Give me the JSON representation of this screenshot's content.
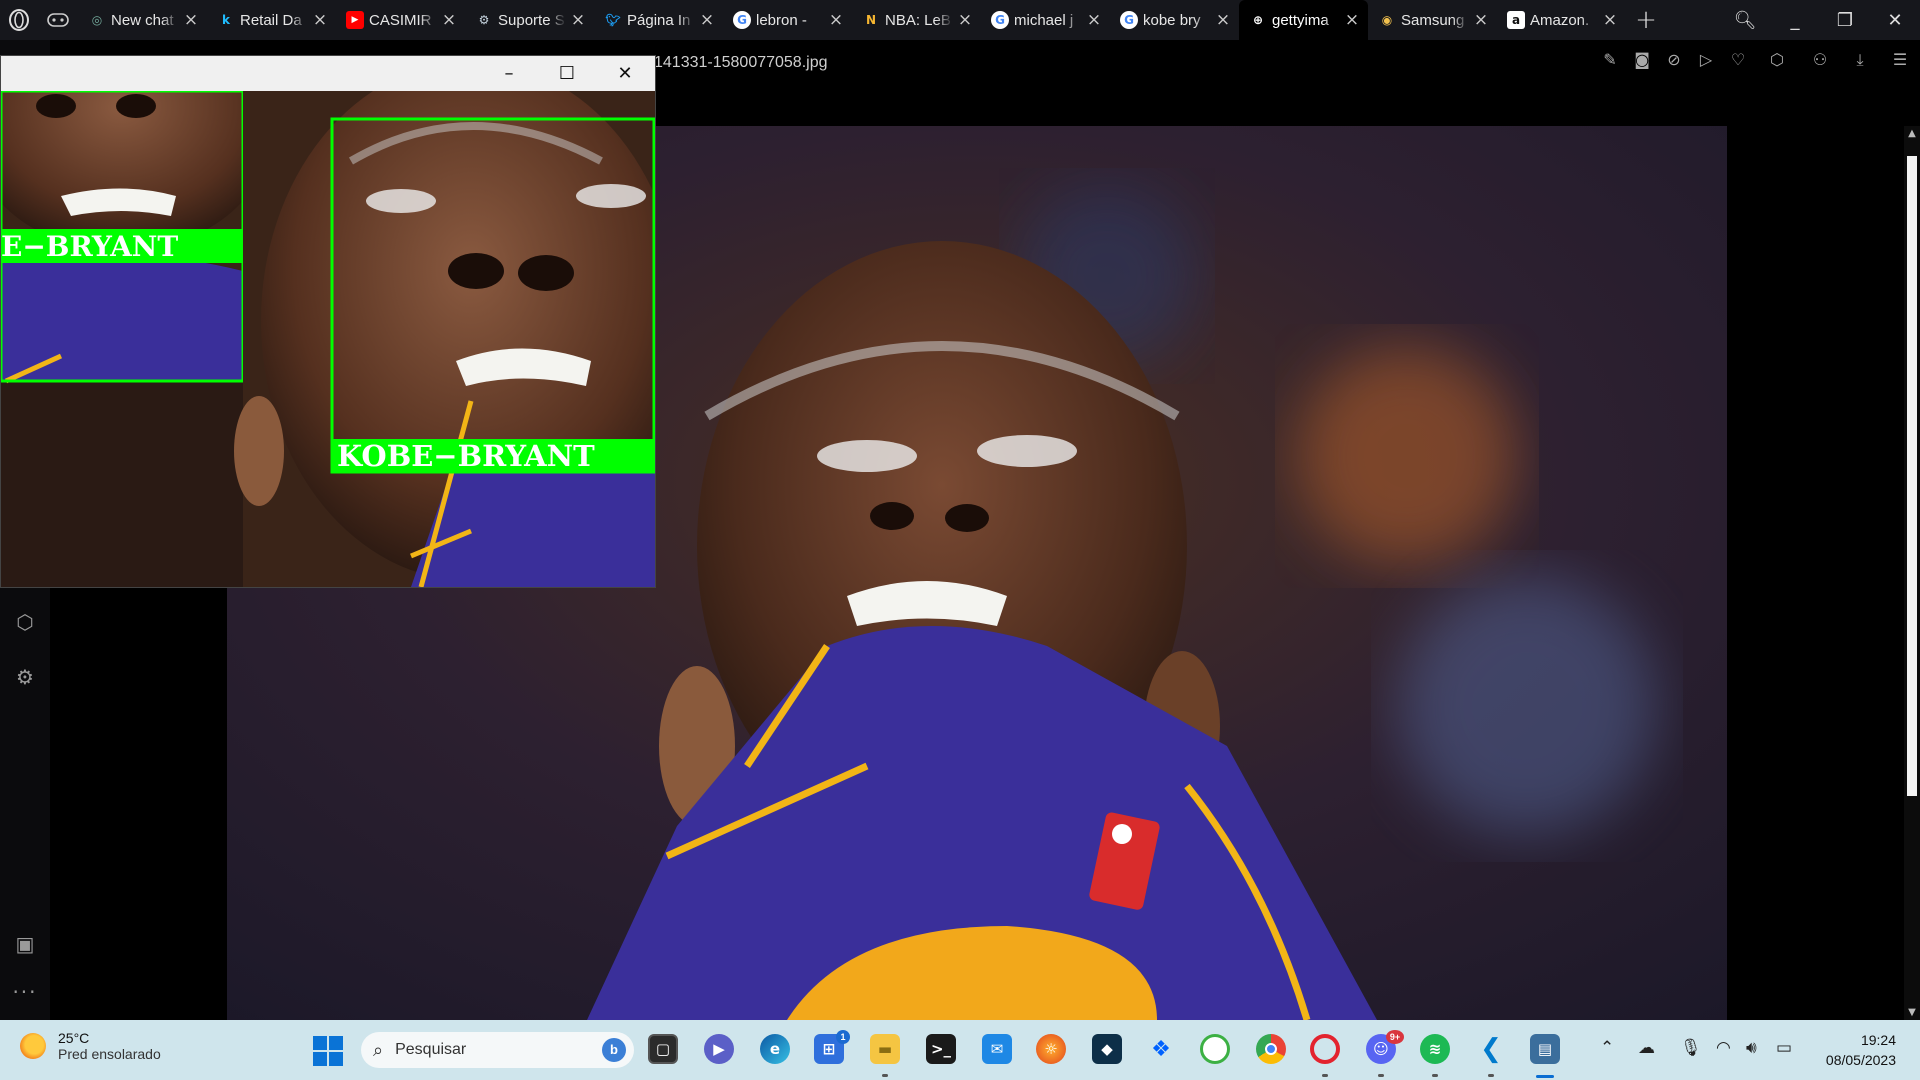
{
  "browser": {
    "tabs": [
      {
        "title": "New chat",
        "icon": "chatgpt-icon",
        "color": "#74aa9c"
      },
      {
        "title": "Retail Da",
        "icon": "kaggle-icon",
        "color": "#20beff"
      },
      {
        "title": "CASIMIR",
        "icon": "youtube-icon",
        "color": "#ff0000"
      },
      {
        "title": "Suporte S",
        "icon": "steam-icon",
        "color": "#c7d5e0"
      },
      {
        "title": "Página In",
        "icon": "twitter-icon",
        "color": "#1d9bf0"
      },
      {
        "title": "lebron -",
        "icon": "google-icon",
        "color": "#4285f4"
      },
      {
        "title": "NBA: LeB",
        "icon": "nba-icon",
        "color": "#f7b731"
      },
      {
        "title": "michael j",
        "icon": "google-icon",
        "color": "#4285f4"
      },
      {
        "title": "kobe bry",
        "icon": "google-icon",
        "color": "#4285f4"
      },
      {
        "title": "gettyima",
        "icon": "globe-icon",
        "color": "#ffffff",
        "active": true
      },
      {
        "title": "Samsung",
        "icon": "samsung-icon",
        "color": "#f2c14e"
      },
      {
        "title": "Amazon.",
        "icon": "amazon-icon",
        "color": "#ffffff"
      }
    ],
    "window_controls": [
      "_",
      "❐",
      "✕"
    ]
  },
  "viewer": {
    "filename": "141331-1580077058.jpg"
  },
  "popup": {
    "label": "KOBE−BRYANT",
    "label_cropped": "E−BRYANT",
    "box_color": "#00ff00"
  },
  "taskbar": {
    "weather_temp": "25°C",
    "weather_desc": "Pred ensolarado",
    "search_placeholder": "Pesquisar",
    "time": "19:24",
    "date": "08/05/2023",
    "teams_badge": "1",
    "discord_badge": "9+"
  }
}
